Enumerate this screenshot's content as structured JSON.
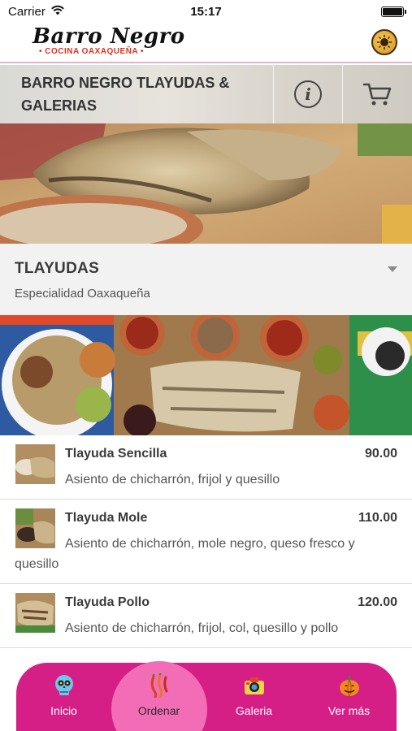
{
  "status_bar": {
    "carrier": "Carrier",
    "time": "15:17"
  },
  "brand": {
    "name": "Barro Negro",
    "tagline": "• COCINA OAXAQUEÑA •"
  },
  "restaurant": {
    "title": "BARRO NEGRO TLAYUDAS & GALERIAS"
  },
  "category": {
    "title": "TLAYUDAS",
    "subtitle": "Especialidad Oaxaqueña"
  },
  "menu_items": [
    {
      "name": "Tlayuda Sencilla",
      "price": "90.00",
      "description": "Asiento de chicharrón, frijol y quesillo"
    },
    {
      "name": "Tlayuda Mole",
      "price": "110.00",
      "description": "Asiento de chicharrón, mole negro, queso fresco y quesillo"
    },
    {
      "name": "Tlayuda Pollo",
      "price": "120.00",
      "description": "Asiento de chicharrón, frijol, col, quesillo y pollo"
    }
  ],
  "bottom_nav": [
    {
      "label": "Inicio",
      "icon": "skull-icon"
    },
    {
      "label": "Ordenar",
      "icon": "chili-icon",
      "active": true
    },
    {
      "label": "Galeria",
      "icon": "camera-icon"
    },
    {
      "label": "Ver más",
      "icon": "pumpkin-icon"
    }
  ],
  "colors": {
    "accent": "#d61e87",
    "accent_active": "#f26db5",
    "brand_red": "#e0301e",
    "header_border": "#e2b1c8"
  }
}
